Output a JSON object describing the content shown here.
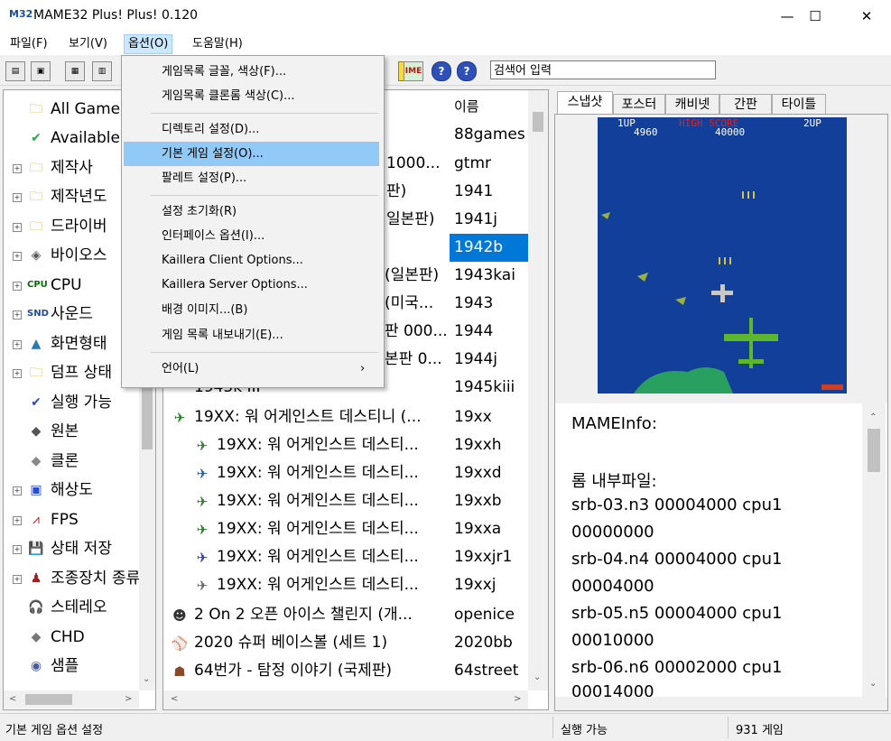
{
  "window": {
    "title": "MAME32 Plus! Plus! 0.120",
    "minimize": "—",
    "maximize": "☐",
    "close": "✕"
  },
  "menubar": [
    "파일(F)",
    "보기(V)",
    "옵션(O)",
    "도움말(H)"
  ],
  "search": {
    "value": "검색어 입력"
  },
  "options_menu": [
    "게임목록 글꼴, 색상(F)...",
    "게임목록 클론롬 색상(C)...",
    "디렉토리 설정(D)...",
    "기본 게임 설정(O)...",
    "팔레트 설정(P)...",
    "설정 초기화(R)",
    "인터페이스 옵션(I)...",
    "Kaillera Client Options...",
    "Kaillera Server Options...",
    "배경 이미지...(B)",
    "게임 목록 내보내기(E)...",
    "언어(L)"
  ],
  "tree": [
    {
      "label": "All Games",
      "icon": "folder-icon"
    },
    {
      "label": "Available",
      "icon": "check-icon"
    },
    {
      "label": "제작사",
      "icon": "folder-icon"
    },
    {
      "label": "제작년도",
      "icon": "folder-icon"
    },
    {
      "label": "드라이버",
      "icon": "folder-icon"
    },
    {
      "label": "바이오스",
      "icon": "chip-icon"
    },
    {
      "label": "CPU",
      "icon": "cpu-icon"
    },
    {
      "label": "사운드",
      "icon": "sound-icon"
    },
    {
      "label": "화면형태",
      "icon": "screen-icon"
    },
    {
      "label": "덤프 상태",
      "icon": "folder-icon"
    },
    {
      "label": "실행 가능",
      "icon": "check-icon"
    },
    {
      "label": "원본",
      "icon": "disk-icon"
    },
    {
      "label": "클론",
      "icon": "disk-icon"
    },
    {
      "label": "해상도",
      "icon": "monitor-icon"
    },
    {
      "label": "FPS",
      "icon": "graph-icon"
    },
    {
      "label": "상태 저장",
      "icon": "save-icon"
    },
    {
      "label": "조종장치 종류",
      "icon": "joystick-icon"
    },
    {
      "label": "스테레오",
      "icon": "headphone-icon"
    },
    {
      "label": "CHD",
      "icon": "disk-icon"
    },
    {
      "label": "샘플",
      "icon": "sample-icon"
    }
  ],
  "list": {
    "column_rom": "이름",
    "rows": [
      {
        "name": "",
        "rom": "88games"
      },
      {
        "name": "1000...",
        "rom": "gtmr"
      },
      {
        "name": "판)",
        "rom": "1941"
      },
      {
        "name": "일본판)",
        "rom": "1941j"
      },
      {
        "name": "",
        "rom": "1942b"
      },
      {
        "name": "(일본판)",
        "rom": "1943kai"
      },
      {
        "name": "(미국...",
        "rom": "1943"
      },
      {
        "name": "판 000...",
        "rom": "1944"
      },
      {
        "name": "본판 0...",
        "rom": "1944j"
      },
      {
        "name": "1945k III",
        "rom": "1945kiii"
      },
      {
        "name": "19XX: 워 어게인스트 데스티니 (...",
        "rom": "19xx"
      },
      {
        "name": "19XX: 워 어게인스트 데스티...",
        "rom": "19xxh"
      },
      {
        "name": "19XX: 워 어게인스트 데스티...",
        "rom": "19xxd"
      },
      {
        "name": "19XX: 워 어게인스트 데스티...",
        "rom": "19xxb"
      },
      {
        "name": "19XX: 워 어게인스트 데스티...",
        "rom": "19xxa"
      },
      {
        "name": "19XX: 워 어게인스트 데스티...",
        "rom": "19xxjr1"
      },
      {
        "name": "19XX: 워 어게인스트 데스티...",
        "rom": "19xxj"
      },
      {
        "name": "2 On 2 오픈 아이스 챌린지 (개...",
        "rom": "openice"
      },
      {
        "name": "2020 슈퍼 베이스볼 (세트 1)",
        "rom": "2020bb"
      },
      {
        "name": "64번가 - 탐정 이야기 (국제판)",
        "rom": "64street"
      }
    ]
  },
  "tabs": [
    "스냅샷",
    "포스터",
    "캐비넷",
    "간판",
    "타이틀"
  ],
  "snapshot": {
    "p1": "1UP",
    "p1_score": "4960",
    "hi_label": "HIGH SCORE",
    "hi_score": "40000",
    "p2": "2UP"
  },
  "info": [
    "MAMEInfo:",
    "",
    "롬 내부파일:",
    " srb-03.n3 00004000 cpu1",
    "00000000",
    " srb-04.n4 00004000 cpu1",
    "00004000",
    " srb-05.n5 00004000 cpu1",
    "00010000",
    " srb-06.n6 00002000 cpu1",
    "00014000"
  ],
  "status": {
    "left": "기본 게임 옵션 설정",
    "middle": "실행 가능",
    "right": "931 게임"
  }
}
